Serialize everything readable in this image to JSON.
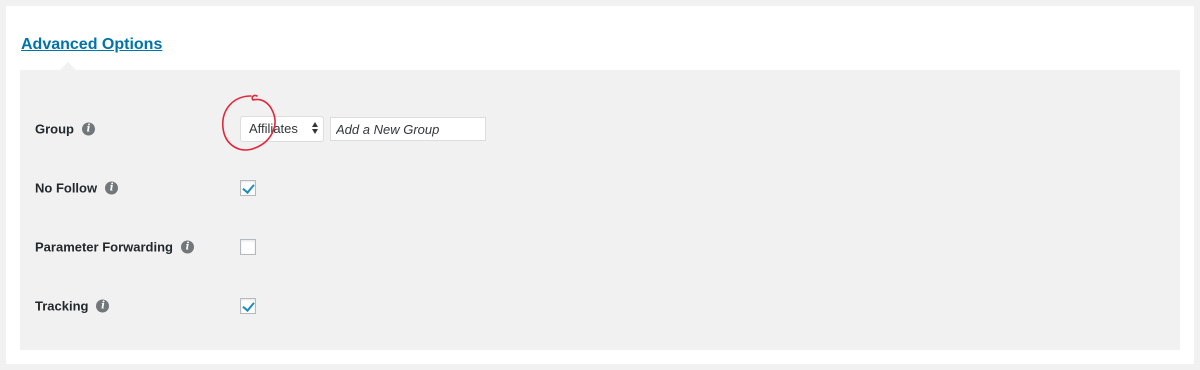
{
  "section": {
    "toggle_label": "Advanced Options"
  },
  "fields": {
    "group": {
      "label": "Group",
      "select_value": "Affiliates",
      "new_group_placeholder": "Add a New Group"
    },
    "no_follow": {
      "label": "No Follow",
      "checked": true
    },
    "parameter_forwarding": {
      "label": "Parameter Forwarding",
      "checked": false
    },
    "tracking": {
      "label": "Tracking",
      "checked": true
    }
  },
  "icons": {
    "info": "info-icon",
    "info_glyph": "i"
  },
  "colors": {
    "link": "#0073aa",
    "panel_bg": "#f1f1f1",
    "checkmark": "#1e8cbe",
    "annotation": "#e0283c"
  }
}
